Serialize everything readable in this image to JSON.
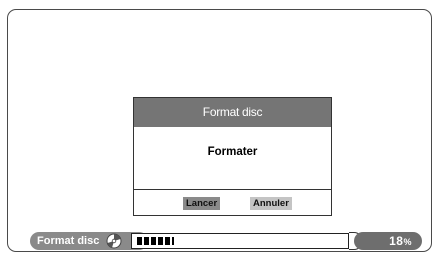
{
  "dialog": {
    "title": "Format disc",
    "message": "Formater",
    "buttons": {
      "start": "Lancer",
      "cancel": "Annuler"
    }
  },
  "status_bar": {
    "label": "Format disc",
    "icon": "disc-icon",
    "progress_fraction": 0.18,
    "percent_value": "18",
    "percent_unit": "%"
  }
}
